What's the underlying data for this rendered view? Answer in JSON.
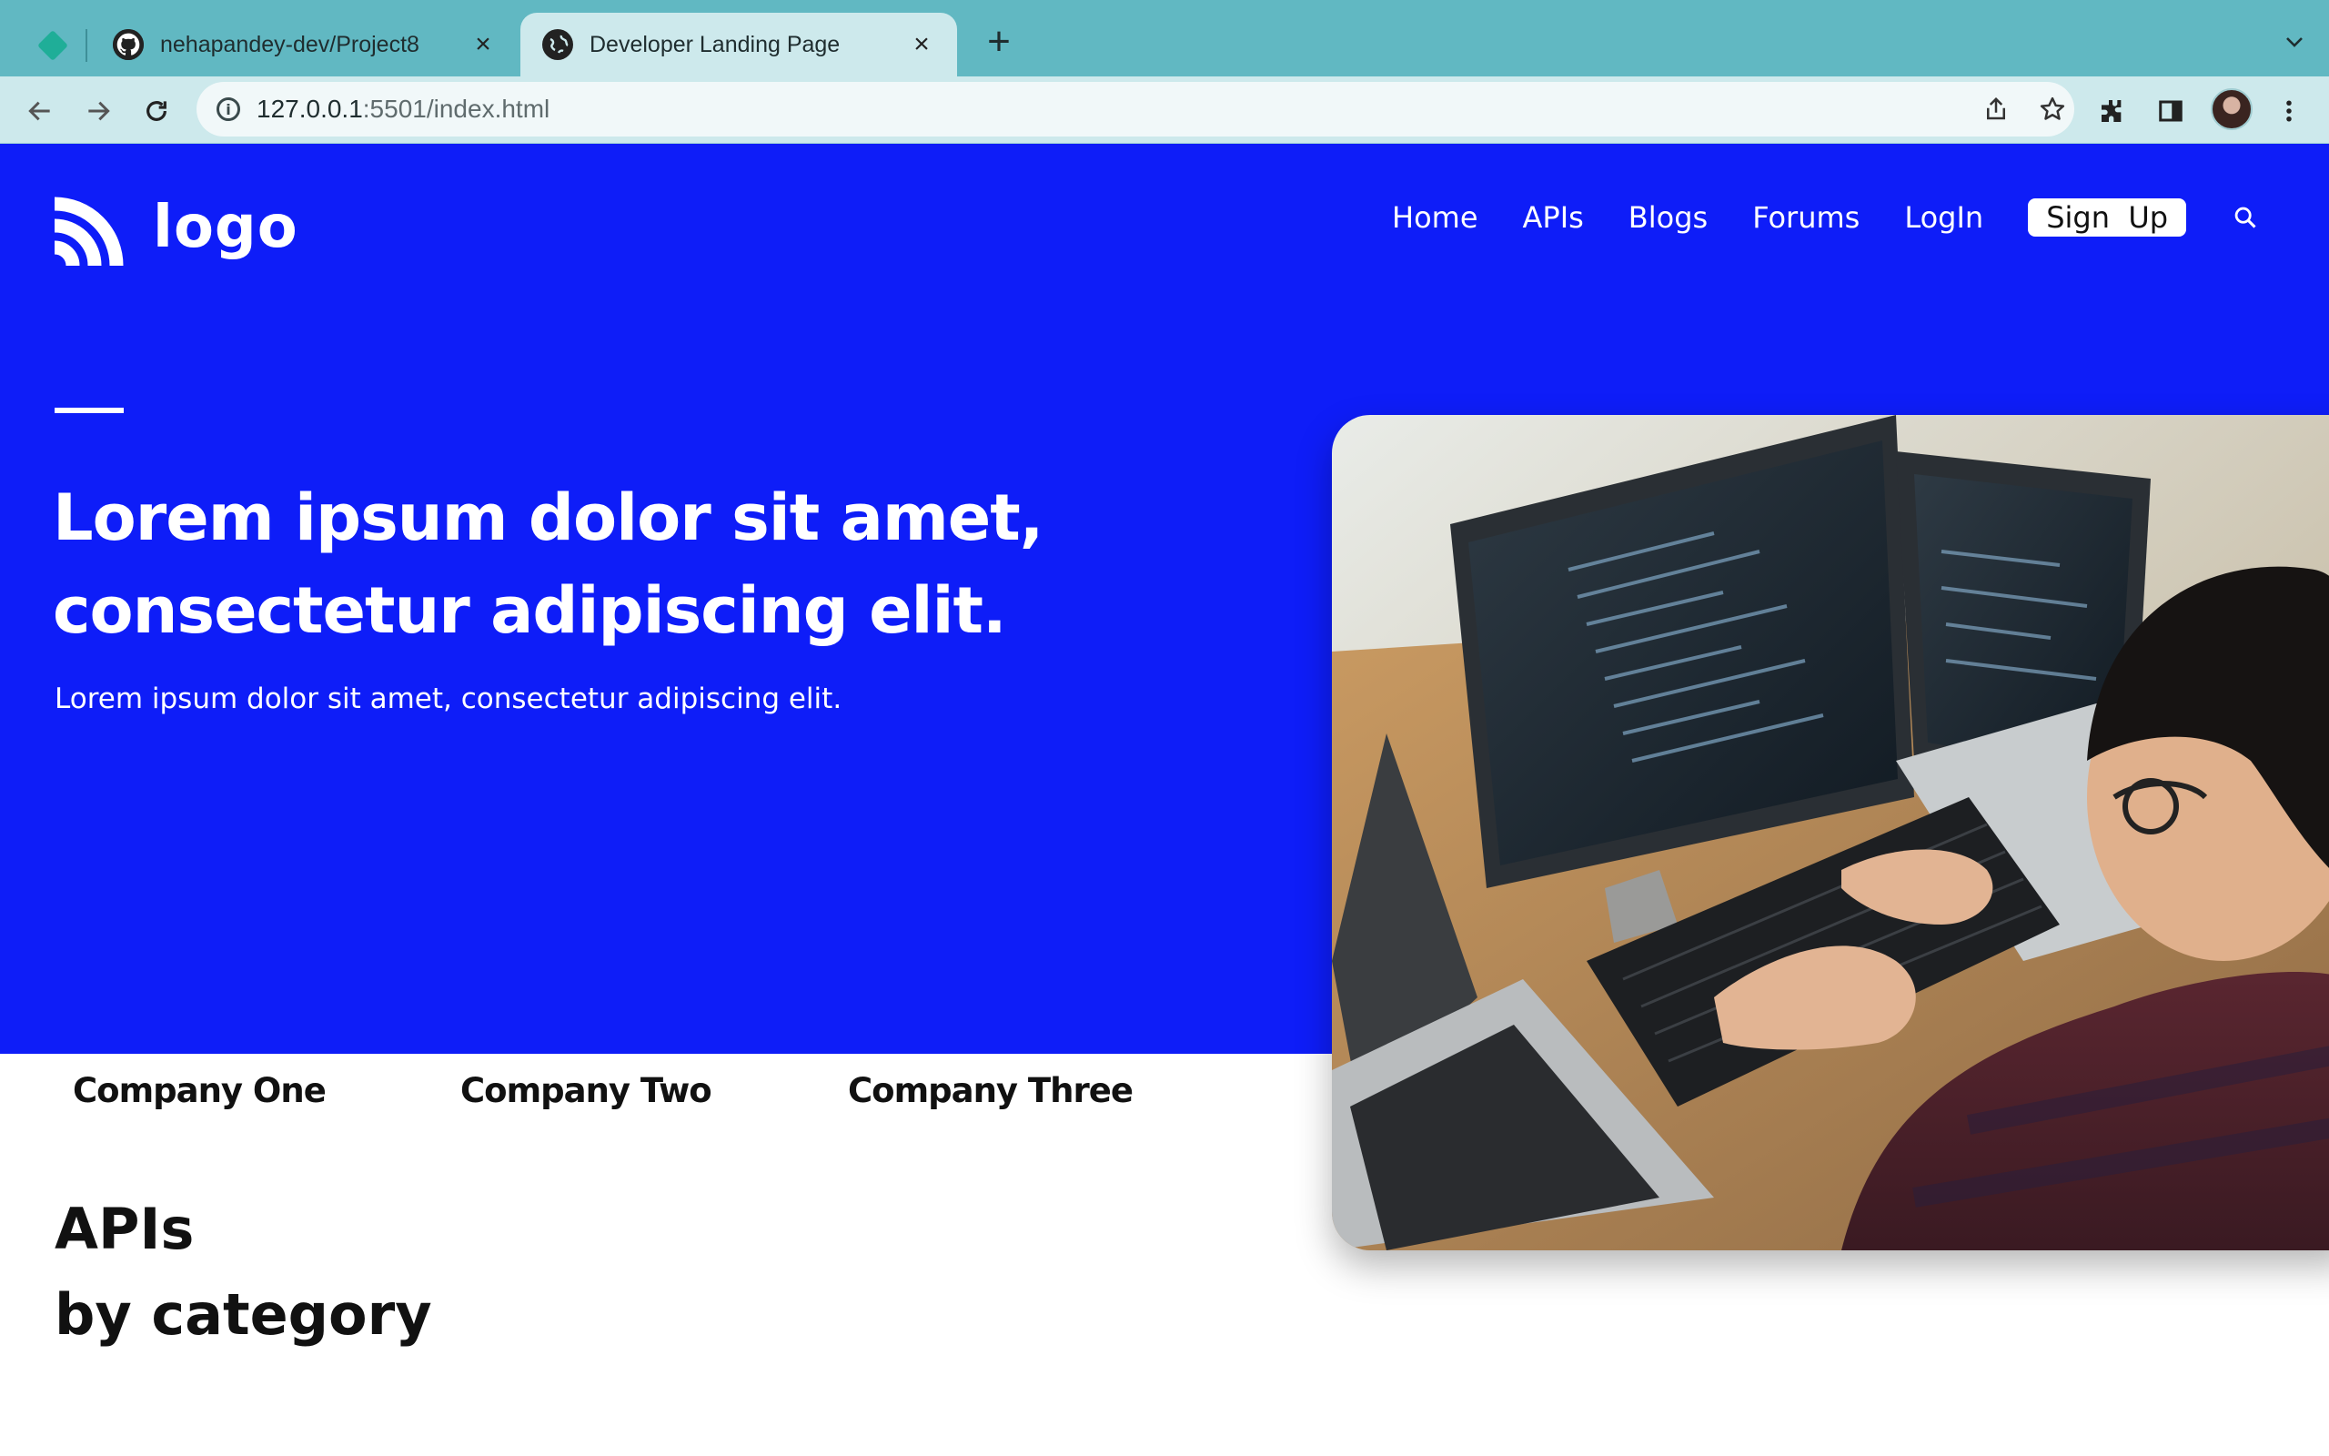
{
  "browser": {
    "tabs": [
      {
        "title": "nehapandey-dev/Project8",
        "icon": "github-icon",
        "active": false
      },
      {
        "title": "Developer Landing Page",
        "icon": "globe-icon",
        "active": true
      }
    ],
    "close_glyph": "×",
    "newtab_glyph": "+",
    "url_host": "127.0.0.1",
    "url_rest": ":5501/index.html"
  },
  "site": {
    "logo_text": "logo",
    "nav": [
      "Home",
      "APIs",
      "Blogs",
      "Forums",
      "LogIn"
    ],
    "signup_label": "Sign  Up",
    "hero": {
      "title_line1": "Lorem ipsum dolor sit amet,",
      "title_line2": "consectetur adipiscing elit.",
      "subtitle": "Lorem ipsum dolor sit amet, consectetur adipiscing elit."
    },
    "companies": [
      "Company One",
      "Company Two",
      "Company Three"
    ],
    "apis_line1": "APIs",
    "apis_line2": "by category"
  },
  "colors": {
    "hero_blue": "#0e1df8",
    "tabbar": "#61b8c2",
    "toolbar": "#cde9ec"
  }
}
